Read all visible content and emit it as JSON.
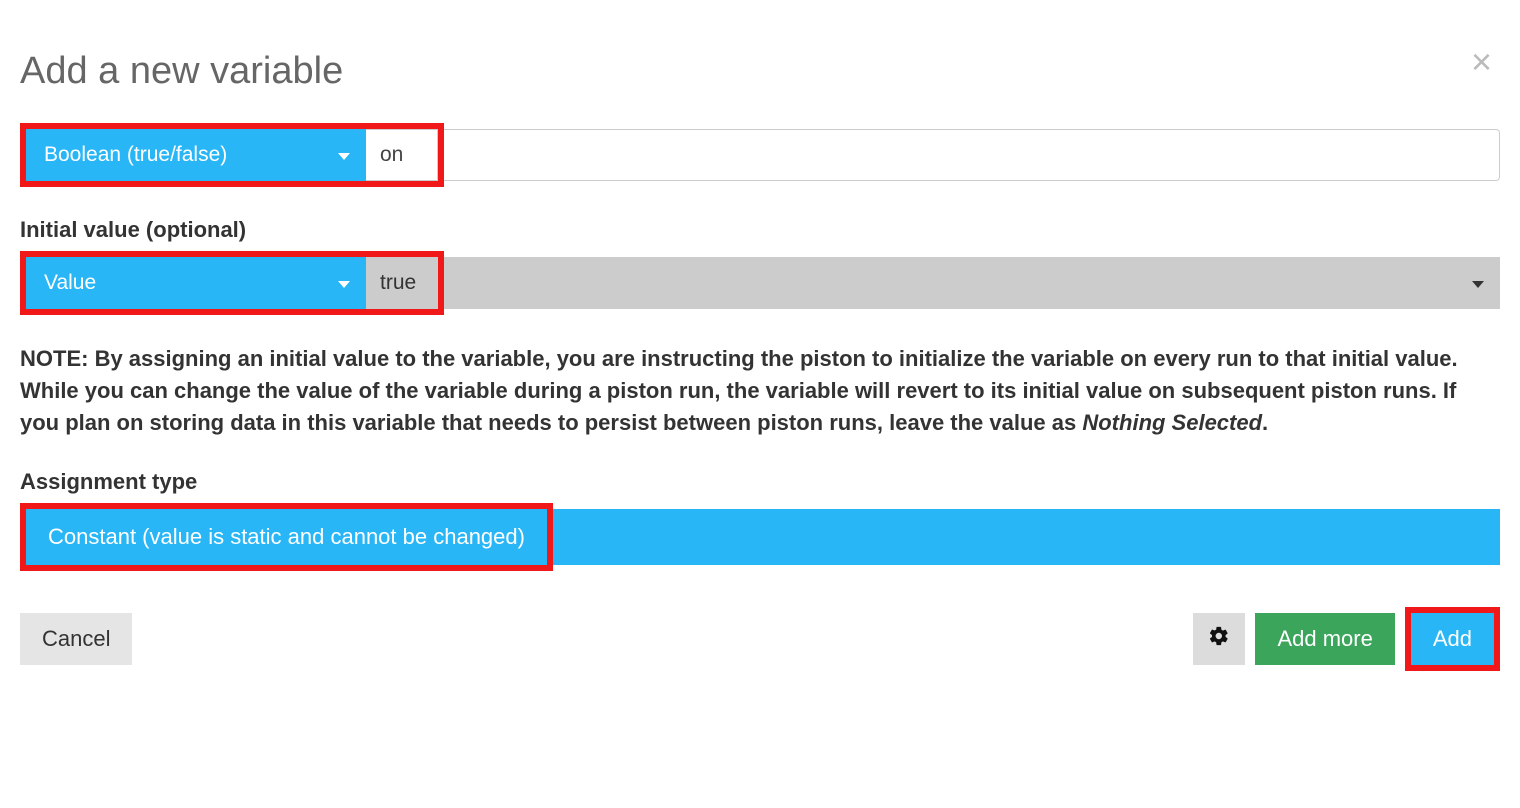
{
  "title": "Add a new variable",
  "type_select": {
    "label": "Boolean (true/false)"
  },
  "name_input": {
    "value": "on"
  },
  "initial_value": {
    "label": "Initial value (optional)",
    "mode": "Value",
    "value": "true"
  },
  "note": {
    "prefix": "NOTE:",
    "body": " By assigning an initial value to the variable, you are instructing the piston to initialize the variable on every run to that initial value. While you can change the value of the variable during a piston run, the variable will revert to its initial value on subsequent piston runs. If you plan on storing data in this variable that needs to persist between piston runs, leave the value as ",
    "em": "Nothing Selected",
    "suffix": "."
  },
  "assignment": {
    "label": "Assignment type",
    "value": "Constant (value is static and cannot be changed)"
  },
  "footer": {
    "cancel": "Cancel",
    "add_more": "Add more",
    "add": "Add"
  },
  "highlight_color": "#f01818",
  "accent_color": "#29b6f6"
}
